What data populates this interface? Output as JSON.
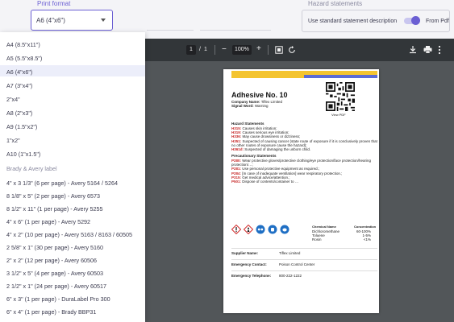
{
  "top": {
    "print_format_label": "Print format",
    "print_format_value": "A6 (4\"x6\")",
    "hazard_label": "Hazard statements",
    "hazard_option": "Use standard statement description",
    "hazard_toggle_on": true,
    "hazard_from": "From Pdf"
  },
  "dropdown": {
    "items": [
      "A4 (8.5\"x11\")",
      "A5 (5.5\"x8.5\")",
      "A6 (4\"x6\")",
      "A7 (3\"x4\")",
      "2\"x4\"",
      "A8 (2\"x3\")",
      "A9 (1.5\"x2\")",
      "1\"x2\"",
      "A10 (1\"x1.5\")"
    ],
    "selected_index": 2,
    "group_label": "Brady & Avery label",
    "group_items": [
      "4\" x 3 1/3\" (6 per page) - Avery 5164 / 5264",
      "8 1/8\" x 5\" (2 per page) - Avery 6573",
      "8 1/2\" x 11\" (1 per page) - Avery 5255",
      "4\" x 6\" (1 per page) - Avery 5292",
      "4\" x 2\" (10 per page) - Avery 5163 / 8163 / 60505",
      "2 5/8\" x 1\" (30 per page) - Avery 5160",
      "2\" x 2\" (12 per page) - Avery 60506",
      "3 1/2\" x 5\" (4 per page) - Avery 60503",
      "2 1/2\" x 1\" (24 per page) - Avery 60517",
      "6\" x 3\" (1 per page) - DuraLabel Pro 300",
      "6\" x 4\" (1 per page) - Brady BBP31"
    ]
  },
  "viewer": {
    "page_current": "1",
    "page_sep": "/",
    "page_total": "1",
    "zoom": "100%",
    "minus": "−",
    "plus": "+",
    "icons": [
      "menu-icon",
      "fit-page-icon",
      "rotate-icon",
      "download-icon",
      "print-icon",
      "more-icon"
    ]
  },
  "label": {
    "title": "Adhesive No. 10",
    "company_key": "Company Name:",
    "company_val": "Tiflex Limited",
    "signal_key": "Signal Word:",
    "signal_val": "Warning",
    "view_pdf": "View PDF",
    "hazard_heading": "Hazard Statements",
    "hazard_lines": [
      {
        "code": "H315:",
        "text": "Causes skin irritation;"
      },
      {
        "code": "H319:",
        "text": "Causes serious eye irritation;"
      },
      {
        "code": "H336:",
        "text": "May cause drowsiness or dizziness;"
      },
      {
        "code": "H351:",
        "text": "Suspected of causing cancer (state route of exposure if it is conclusively proven that"
      },
      {
        "code": "",
        "text": "no other routes of exposure cause the hazard);"
      },
      {
        "code": "H361d:",
        "text": "Suspected of damaging the unborn child."
      }
    ],
    "precaution_heading": "Precautionary Statements",
    "precaution_lines": [
      {
        "code": "P280:",
        "text": "Wear protective gloves/protective clothing/eye protection/face protection/hearing"
      },
      {
        "code": "",
        "text": "protection/…;"
      },
      {
        "code": "P281:",
        "text": "Use personal protective equipment as required.;"
      },
      {
        "code": "P284:",
        "text": "[In case of inadequate ventilation] wear respiratory protection.;"
      },
      {
        "code": "P315:",
        "text": "Get medical advice/attention.;"
      },
      {
        "code": "P501:",
        "text": "Dispose of contents/container to …"
      }
    ],
    "chem_header_name": "Chemical Name",
    "chem_header_conc": "Concentration",
    "chemicals": [
      {
        "name": "Dichloromethane",
        "conc": "60-100%"
      },
      {
        "name": "Toluene",
        "conc": "1-5%"
      },
      {
        "name": "Rosin",
        "conc": "<1%"
      }
    ],
    "supplier_key": "Supplier Name:",
    "supplier_val": "Tiflex Limited",
    "emergency_key": "Emergency Contact:",
    "emergency_val": "Poison Control Center",
    "phone_key": "Emergency Telephone:",
    "phone_val": "800-222-1222"
  },
  "colors": {
    "accent": "#6b5fd3",
    "stripe_yellow": "#f4c430",
    "stripe_blue": "#5b6bd6",
    "pictogram_red": "#d32f2f",
    "ppe_blue": "#1f6fc4"
  }
}
